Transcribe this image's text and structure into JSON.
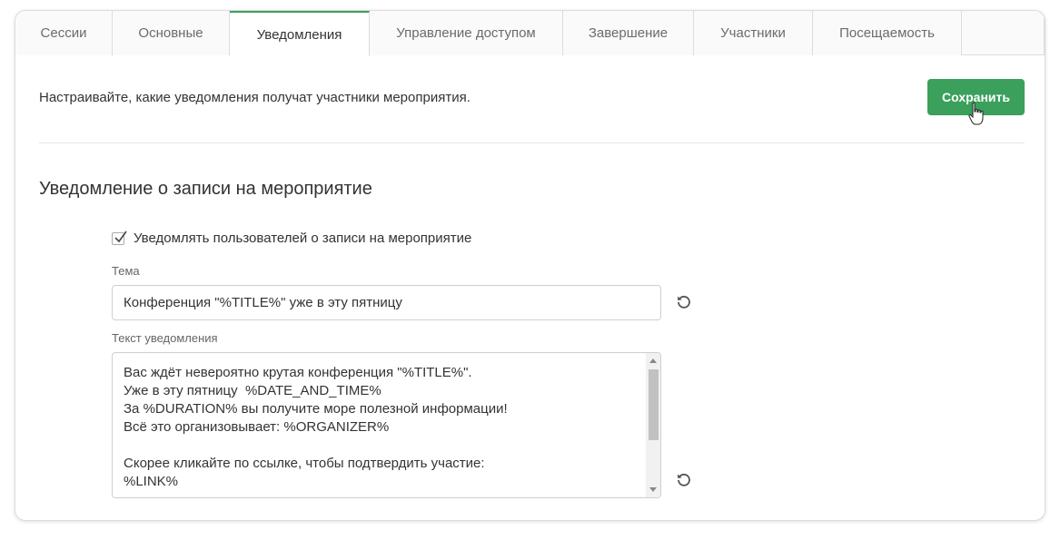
{
  "tabs": [
    {
      "label": "Сессии",
      "active": false
    },
    {
      "label": "Основные",
      "active": false
    },
    {
      "label": "Уведомления",
      "active": true
    },
    {
      "label": "Управление доступом",
      "active": false
    },
    {
      "label": "Завершение",
      "active": false
    },
    {
      "label": "Участники",
      "active": false
    },
    {
      "label": "Посещаемость",
      "active": false
    }
  ],
  "header": {
    "description": "Настраивайте, какие уведомления получат участники мероприятия.",
    "save_label": "Сохранить"
  },
  "section": {
    "title": "Уведомление о записи на мероприятие",
    "checkbox_label": "Уведомлять пользователей о записи на мероприятие",
    "checkbox_checked": true,
    "subject_label": "Тема",
    "subject_value": "Конференция \"%TITLE%\" уже в эту пятницу",
    "body_label": "Текст уведомления",
    "body_lines": [
      "Вас ждёт невероятно крутая конференция \"%TITLE%\".",
      "Уже в эту пятницу  %DATE_AND_TIME%",
      "За %DURATION% вы получите море полезной информации!",
      "Всё это организовывает: %ORGANIZER%",
      "",
      "Скорее кликайте по ссылке, чтобы подтвердить участие:",
      "%LINK%"
    ]
  },
  "colors": {
    "accent": "#3aa05b",
    "border": "#dcdcdc"
  },
  "icons": {
    "reset": "reset-icon",
    "check": "check-icon",
    "cursor": "hand-cursor-icon"
  }
}
